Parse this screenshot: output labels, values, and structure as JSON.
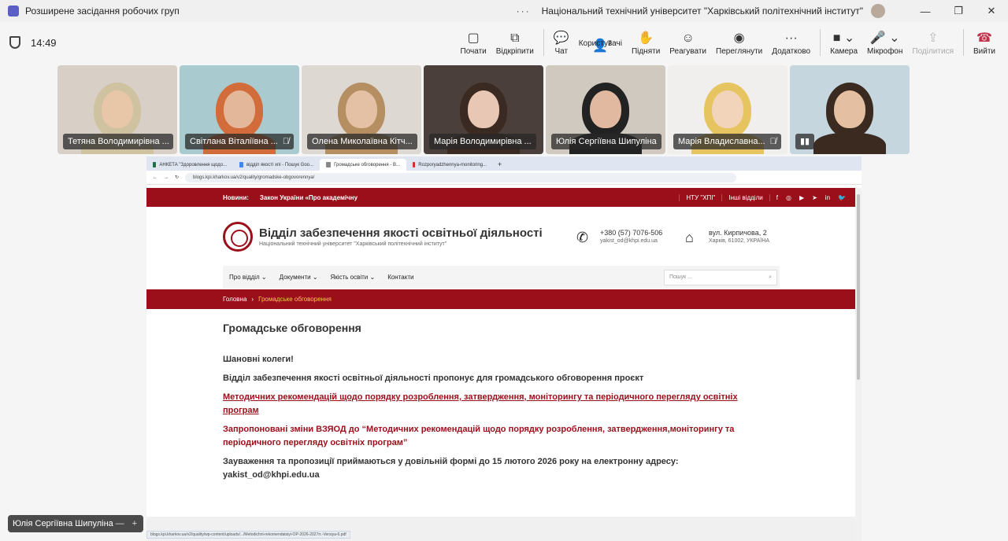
{
  "window": {
    "title": "Розширене засідання робочих груп",
    "more": "···",
    "org": "Національний технічний університет \"Харківський політехнічний інститут\""
  },
  "toolbar": {
    "time": "14:49",
    "buttons": [
      {
        "label": "Почати",
        "icon": "record-icon",
        "glyph": "▢"
      },
      {
        "label": "Відкріпити",
        "icon": "unpin-icon",
        "glyph": "⧉"
      },
      {
        "label": "Чат",
        "icon": "chat-icon",
        "glyph": "💬"
      },
      {
        "label": "Користувачі",
        "icon": "people-icon",
        "glyph": "👤",
        "count": "7"
      },
      {
        "label": "Підняти",
        "icon": "raise-hand-icon",
        "glyph": "✋"
      },
      {
        "label": "Реагувати",
        "icon": "react-icon",
        "glyph": "☺"
      },
      {
        "label": "Переглянути",
        "icon": "view-icon",
        "glyph": "◉"
      },
      {
        "label": "Додатково",
        "icon": "more-icon",
        "glyph": "···"
      }
    ],
    "camera": "Камера",
    "mic": "Мікрофон",
    "share": "Поділитися",
    "leave": "Вийти"
  },
  "participants": [
    {
      "name": "Тетяна Володимирівна ...",
      "bg": "#d8d0c6",
      "face": "#e8c6a8",
      "hair": "#cfc2a0"
    },
    {
      "name": "Світлана Віталіївна ...",
      "bg": "#a9cbd0",
      "face": "#e3b79a",
      "hair": "#d26c3a",
      "muted": true
    },
    {
      "name": "Олена Миколаївна Кітч...",
      "bg": "#ddd8d2",
      "face": "#e4c0a5",
      "hair": "#b58e62"
    },
    {
      "name": "Марія Володимирівна ...",
      "bg": "#4a3f3a",
      "face": "#e8c8b4",
      "hair": "#3b2a22"
    },
    {
      "name": "Юлія Сергіївна Шипуліна",
      "bg": "#cfc9c0",
      "face": "#e0b9a0",
      "hair": "#222222"
    },
    {
      "name": "Марія Владиславна...",
      "bg": "#f0efed",
      "face": "#f1d4b9",
      "hair": "#e6c45f",
      "muted": true
    },
    {
      "name": "",
      "bg": "#c5d6de",
      "face": "#e4bfa1",
      "hair": "#3a2a20",
      "signal": true
    }
  ],
  "browser": {
    "tabs": [
      "АНКЕТА \"Здоровлення щодо...",
      "відділ якості хпі - Пошук Goo...",
      "Громадське обговорення - В...",
      "Rozporyadzhennya-monitoring..."
    ],
    "url": "blogs.kpi.kharkov.ua/v2/quality/gromadske-obgovorennya/"
  },
  "site": {
    "news_label": "Новини:",
    "news_text": "Закон України «Про академічну",
    "ntu_link": "НТУ \"ХПІ\"",
    "other_link": "Інші відділи",
    "socials": [
      "f",
      "◎",
      "▶",
      "➤",
      "in",
      "🐦"
    ],
    "title": "Відділ забезпечення якості освітньої діяльності",
    "subtitle": "Національний технічний університет \"Харківський політехнічний інститут\"",
    "phone": "+380 (57) 7076-506",
    "email": "yakist_od@khpi.edu.ua",
    "address": "вул. Кирпичова, 2",
    "city": "Харків, 61002, УКРАЇНА",
    "nav": [
      "Про відділ",
      "Документи",
      "Якість освіти",
      "Контакти"
    ],
    "search_placeholder": "Пошук ...",
    "crumb_home": "Головна",
    "crumb_current": "Громадське обговорення",
    "heading": "Громадське обговорення",
    "p1": "Шановні колеги!",
    "p2": "Відділ забезпечення якості освітньої діяльності пропонує для громадського обговорення проєкт",
    "link1": "Методичних рекомендацій щодо порядку розроблення, затвердження, моніторингу та періодичного перегляду освітніх програм",
    "link2": "Запропоновані зміни ВЗЯОД до “Методичних рекомендацій щодо порядку розроблення, затвердження,моніторингу та періодичного перегляду освітніх програм”",
    "p3": "Зауваження та пропозиції  приймаються у довільній формі до 15 лютого 2026 року на електронну адресу:",
    "p3_email": "yakist_od@khpi.edu.ua",
    "status_url": "blogs.kpi.kharkov.ua/v2/quality/wp-content/uploads/.../Metodichni-rekomendatsiyi-OP-2026-2027rr.-Versiya-6.pdf"
  },
  "self_view": {
    "name": "Юлія Сергіївна Шипуліна",
    "minimize": "—",
    "add": "+"
  },
  "colors": {
    "brand_red": "#9b0f1a",
    "teams_purple": "#5b5fc7",
    "leave_red": "#c4314b"
  }
}
